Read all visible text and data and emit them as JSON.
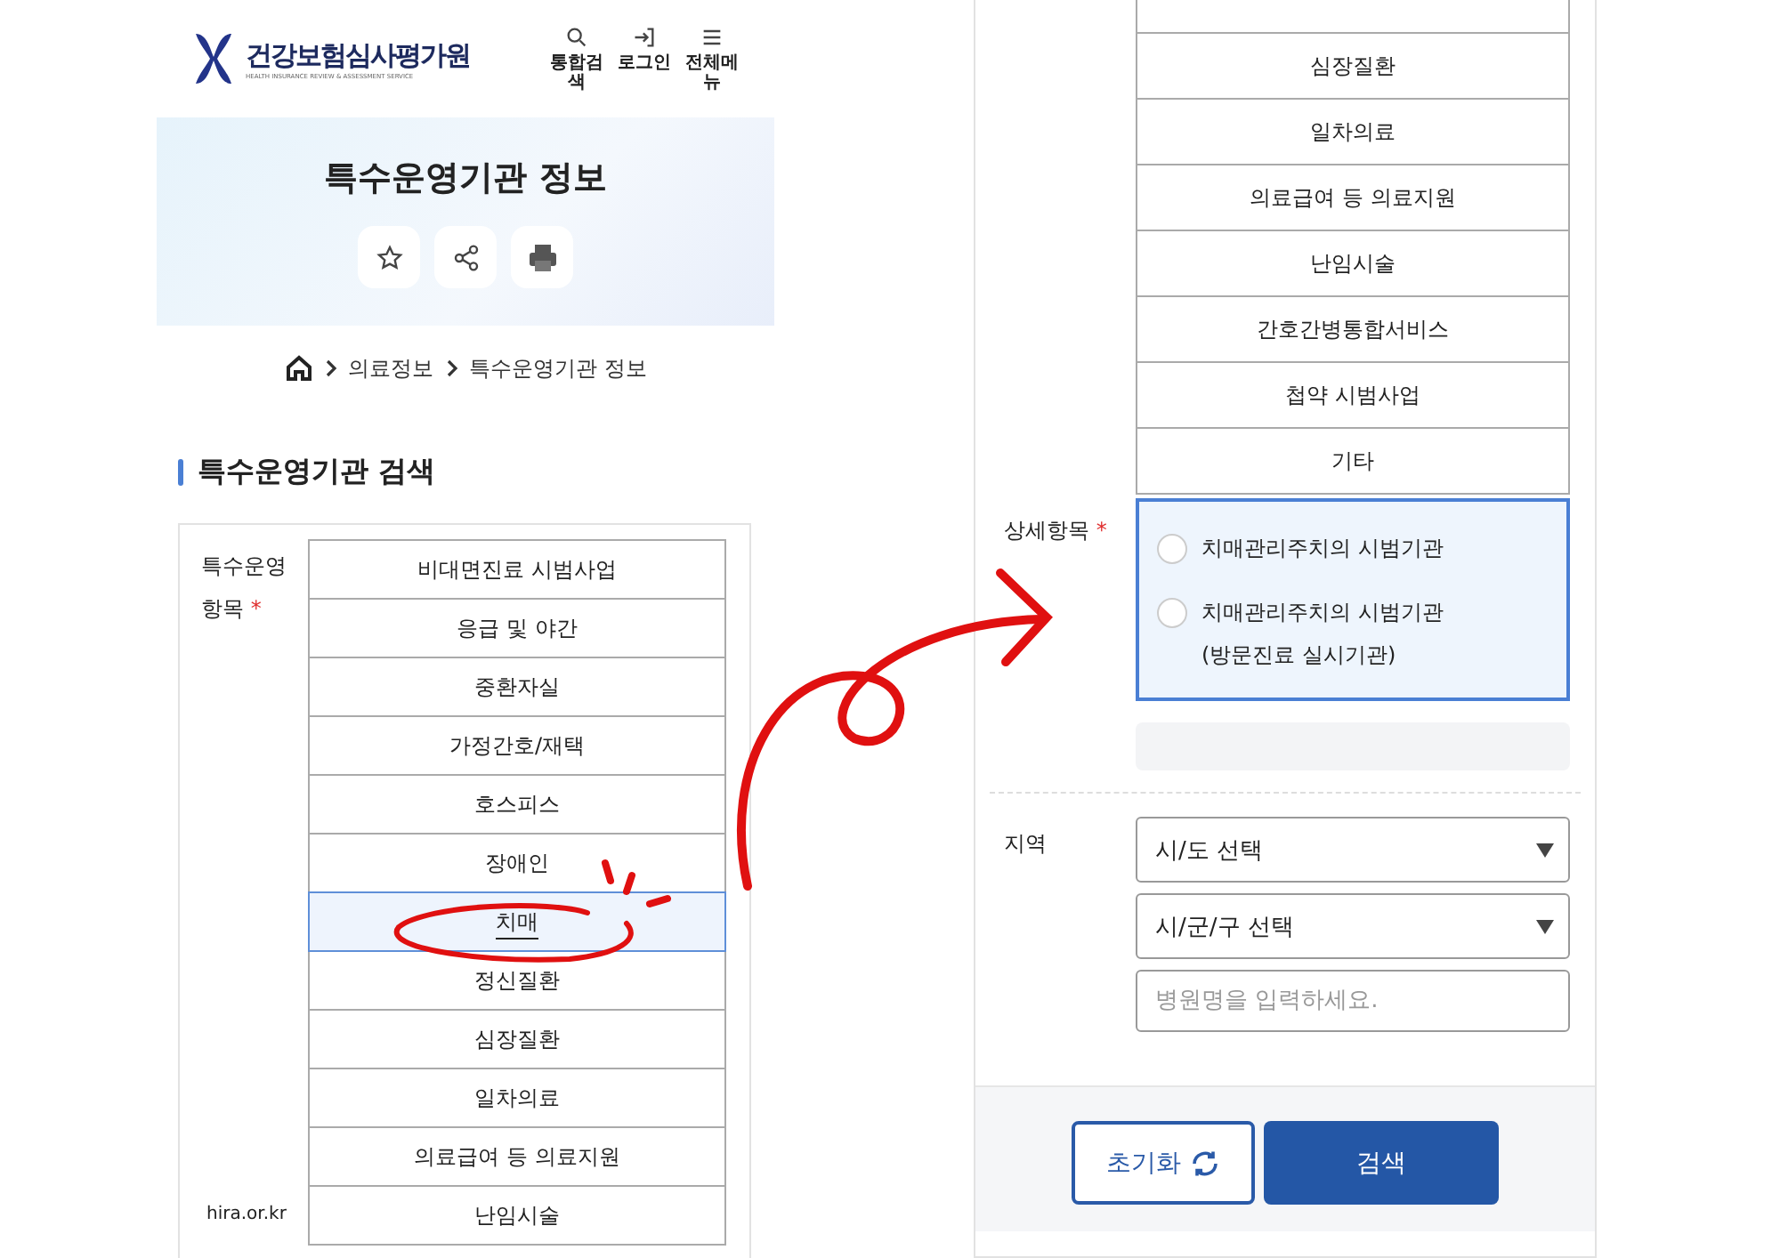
{
  "header": {
    "logo_title": "건강보험심사평가원",
    "logo_subtitle": "HEALTH INSURANCE REVIEW & ASSESSMENT SERVICE",
    "nav": [
      {
        "kind": "search",
        "label": "통합검색"
      },
      {
        "kind": "login",
        "label": "로그인"
      },
      {
        "kind": "menu",
        "label": "전체메뉴"
      }
    ]
  },
  "hero": {
    "title": "특수운영기관 정보",
    "actions": [
      {
        "kind": "star"
      },
      {
        "kind": "share"
      },
      {
        "kind": "print"
      }
    ]
  },
  "breadcrumb": [
    "의료정보",
    "특수운영기관 정보"
  ],
  "search": {
    "title": "특수운영기관 검색",
    "category_label": "특수운영 항목",
    "required_mark": "*",
    "categories": [
      {
        "label": "비대면진료 시범사업",
        "selected": false
      },
      {
        "label": "응급 및 야간",
        "selected": false
      },
      {
        "label": "중환자실",
        "selected": false
      },
      {
        "label": "가정간호/재택",
        "selected": false
      },
      {
        "label": "호스피스",
        "selected": false
      },
      {
        "label": "장애인",
        "selected": false
      },
      {
        "label": "치매",
        "selected": true
      },
      {
        "label": "정신질환",
        "selected": false
      },
      {
        "label": "심장질환",
        "selected": false
      },
      {
        "label": "일차의료",
        "selected": false
      },
      {
        "label": "의료급여 등 의료지원",
        "selected": false
      },
      {
        "label": "난임시술",
        "selected": false
      }
    ]
  },
  "url_bar": "hira.or.kr",
  "detail_screen": {
    "categories": [
      {
        "label": "심장질환",
        "selected": false
      },
      {
        "label": "일차의료",
        "selected": false
      },
      {
        "label": "의료급여 등 의료지원",
        "selected": false
      },
      {
        "label": "난임시술",
        "selected": false
      },
      {
        "label": "간호간병통합서비스",
        "selected": false
      },
      {
        "label": "첩약 시범사업",
        "selected": false
      },
      {
        "label": "기타",
        "selected": false
      }
    ],
    "detail_label": "상세항목",
    "required_mark": "*",
    "detail_options": [
      {
        "label": "치매관리주치의 시범기관",
        "checked": false
      },
      {
        "label": "치매관리주치의 시범기관(방문진료 실시기관)",
        "checked": false
      }
    ],
    "region_label": "지역",
    "selects": [
      "시/도 선택",
      "시/군/구 선택"
    ],
    "name_placeholder": "병원명을 입력하세요.",
    "buttons": [
      {
        "kind": "reset",
        "label": "초기화"
      },
      {
        "kind": "submit",
        "label": "검색"
      }
    ]
  }
}
